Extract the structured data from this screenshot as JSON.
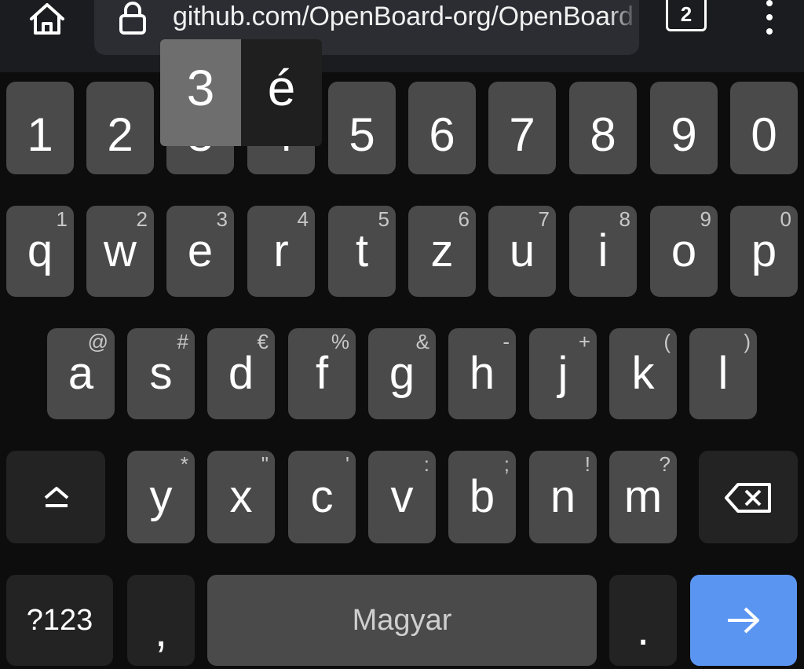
{
  "browser": {
    "url": "github.com/OpenBoard-org/OpenBoard",
    "tab_count": "2"
  },
  "keyboard": {
    "number_row": [
      "1",
      "2",
      "3",
      "4",
      "5",
      "6",
      "7",
      "8",
      "9",
      "0"
    ],
    "row1": [
      {
        "key": "q",
        "hint": "1"
      },
      {
        "key": "w",
        "hint": "2"
      },
      {
        "key": "e",
        "hint": "3"
      },
      {
        "key": "r",
        "hint": "4"
      },
      {
        "key": "t",
        "hint": "5"
      },
      {
        "key": "z",
        "hint": "6"
      },
      {
        "key": "u",
        "hint": "7"
      },
      {
        "key": "i",
        "hint": "8"
      },
      {
        "key": "o",
        "hint": "9"
      },
      {
        "key": "p",
        "hint": "0"
      }
    ],
    "row2": [
      {
        "key": "a",
        "hint": "@"
      },
      {
        "key": "s",
        "hint": "#"
      },
      {
        "key": "d",
        "hint": "€"
      },
      {
        "key": "f",
        "hint": "%"
      },
      {
        "key": "g",
        "hint": "&"
      },
      {
        "key": "h",
        "hint": "-"
      },
      {
        "key": "j",
        "hint": "+"
      },
      {
        "key": "k",
        "hint": "("
      },
      {
        "key": "l",
        "hint": ")"
      }
    ],
    "row3": [
      {
        "key": "y",
        "hint": "*"
      },
      {
        "key": "x",
        "hint": "\""
      },
      {
        "key": "c",
        "hint": "'"
      },
      {
        "key": "v",
        "hint": ":"
      },
      {
        "key": "b",
        "hint": ";"
      },
      {
        "key": "n",
        "hint": "!"
      },
      {
        "key": "m",
        "hint": "?"
      }
    ],
    "symbols_label": "?123",
    "comma_label": ",",
    "space_label": "Magyar",
    "period_label": ".",
    "popup": {
      "options": [
        "3",
        "é"
      ],
      "selected": "3"
    },
    "colors": {
      "key": "#4a4a4a",
      "function_key": "#232323",
      "enter": "#5b95f2",
      "background": "#0d0d0d"
    }
  }
}
